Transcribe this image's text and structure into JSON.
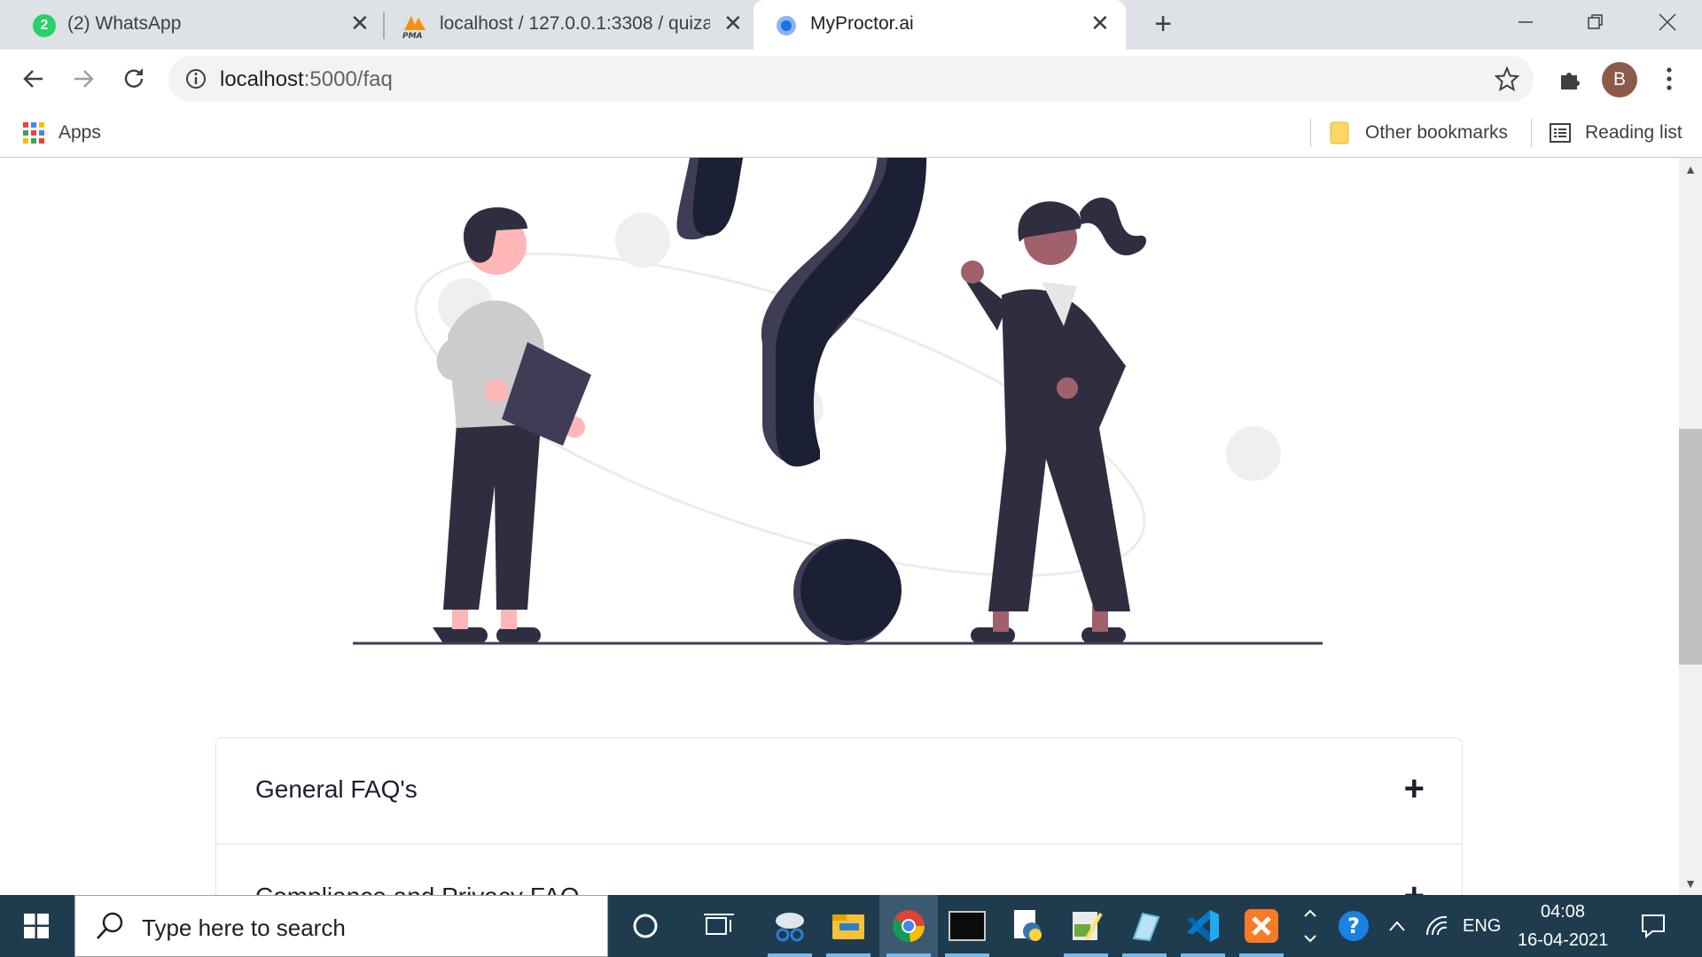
{
  "browser": {
    "tabs": [
      {
        "title": "(2) WhatsApp",
        "badge": "2",
        "active": false
      },
      {
        "title": "localhost / 127.0.0.1:3308 / quiza",
        "favicon_text": "PMA",
        "active": false
      },
      {
        "title": "MyProctor.ai",
        "active": true
      }
    ],
    "url_host": "localhost",
    "url_path": ":5000/faq",
    "profile_initial": "B",
    "bookmarks": {
      "apps_label": "Apps",
      "other_label": "Other bookmarks",
      "reading_label": "Reading list"
    }
  },
  "page": {
    "faq_sections": [
      {
        "title": "General FAQ's",
        "toggle": "+"
      },
      {
        "title": "Compliance and Privacy FAQ",
        "toggle": "+"
      }
    ]
  },
  "taskbar": {
    "search_placeholder": "Type here to search",
    "language": "ENG",
    "time": "04:08",
    "date": "16-04-2021"
  },
  "colors": {
    "tabstrip": "#dee1e6",
    "taskbar": "#1f3c4f",
    "illustration_dark": "#2f2e41",
    "question_mark": "#1b2034",
    "skin_light": "#ffb6b6",
    "skin_dark": "#a0616a",
    "shirt_gray": "#cccccc"
  }
}
